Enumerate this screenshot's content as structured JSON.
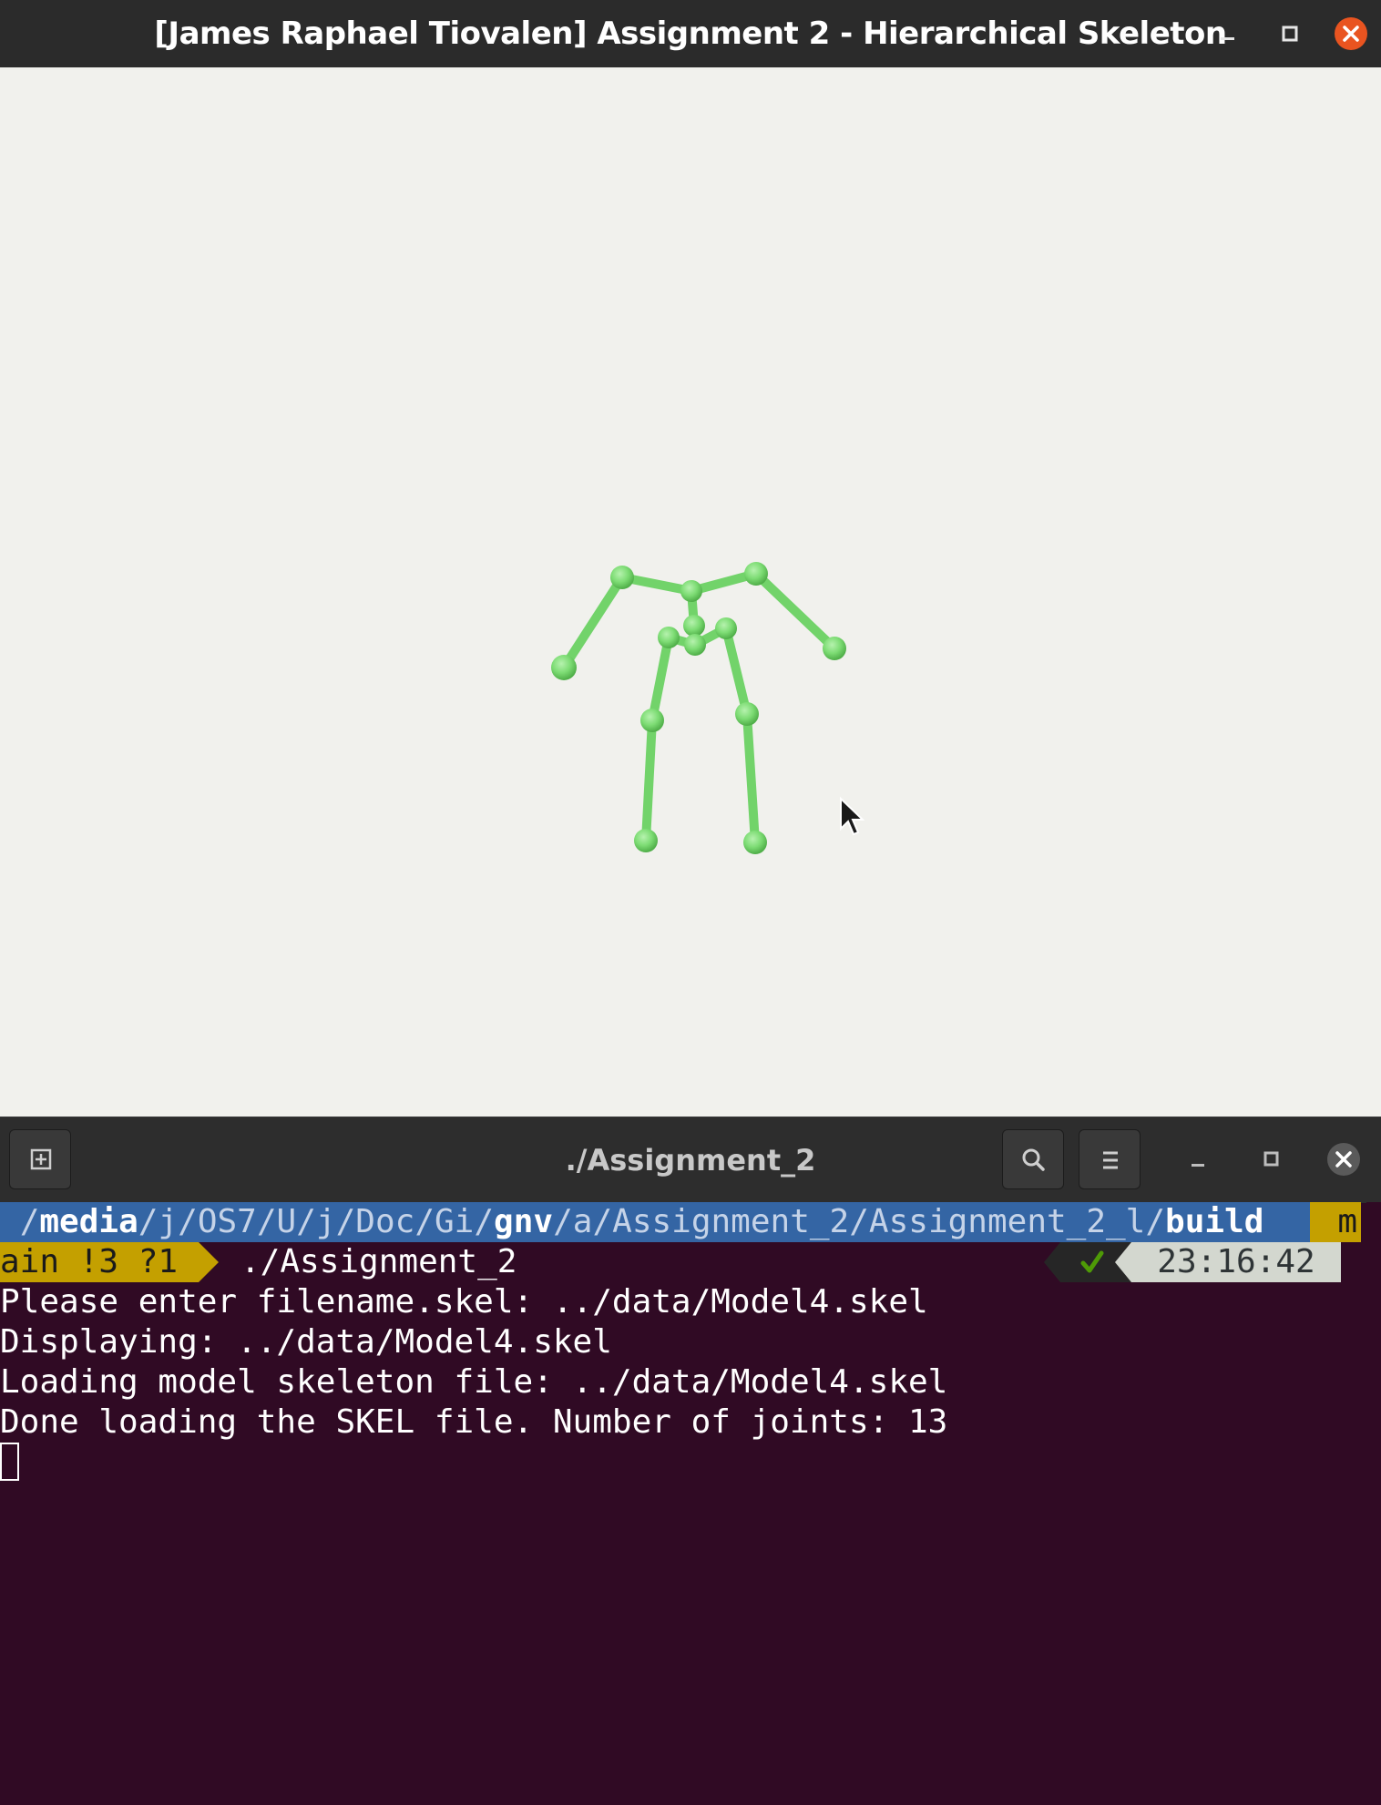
{
  "gl_window": {
    "title": "[James Raphael Tiovalen] Assignment 2 - Hierarchical Skeleton",
    "skeleton_color": "#7ddc74"
  },
  "terminal": {
    "title": "./Assignment_2",
    "prompt": {
      "path_segments": [
        {
          "text": "/",
          "style": "dim"
        },
        {
          "text": "media",
          "style": "strong"
        },
        {
          "text": "/",
          "style": "dim"
        },
        {
          "text": "j",
          "style": "dim"
        },
        {
          "text": "/",
          "style": "dim"
        },
        {
          "text": "OS7",
          "style": "dim"
        },
        {
          "text": "/",
          "style": "dim"
        },
        {
          "text": "U",
          "style": "dim"
        },
        {
          "text": "/",
          "style": "dim"
        },
        {
          "text": "j",
          "style": "dim"
        },
        {
          "text": "/",
          "style": "dim"
        },
        {
          "text": "Doc",
          "style": "dim"
        },
        {
          "text": "/",
          "style": "dim"
        },
        {
          "text": "Gi",
          "style": "dim"
        },
        {
          "text": "/",
          "style": "dim"
        },
        {
          "text": "gnv",
          "style": "strong"
        },
        {
          "text": "/",
          "style": "dim"
        },
        {
          "text": "a",
          "style": "dim"
        },
        {
          "text": "/",
          "style": "dim"
        },
        {
          "text": "Assignment_2",
          "style": "dim"
        },
        {
          "text": "/",
          "style": "dim"
        },
        {
          "text": "Assignment_2_l",
          "style": "dim"
        },
        {
          "text": "/",
          "style": "dim"
        },
        {
          "text": "build",
          "style": "strong"
        }
      ],
      "branch_right": "m",
      "branch": "ain !3 ?1",
      "command": "./Assignment_2",
      "status_icon": "checkmark-icon",
      "time": "23:16:42"
    },
    "output": [
      "Please enter filename.skel: ../data/Model4.skel",
      "Displaying: ../data/Model4.skel",
      "Loading model skeleton file: ../data/Model4.skel",
      "Done loading the SKEL file. Number of joints: 13"
    ],
    "colors": {
      "background": "#300a24",
      "path_bg": "#3465a4",
      "branch_bg": "#c4a000",
      "time_bg": "#d3d7cf",
      "status_ok": "#4e9a06"
    }
  }
}
